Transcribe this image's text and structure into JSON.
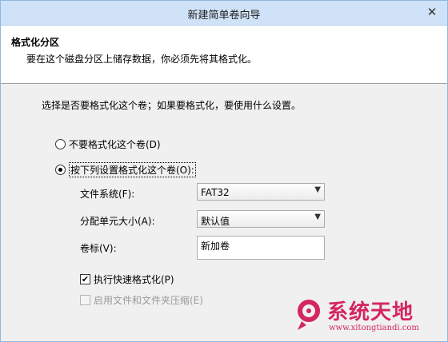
{
  "window": {
    "title": "新建简单卷向导",
    "close_glyph": "✕"
  },
  "header": {
    "title": "格式化分区",
    "subtitle": "要在这个磁盘分区上储存数据，你必须先将其格式化。"
  },
  "main": {
    "description": "选择是否要格式化这个卷；如果要格式化，要使用什么设置。",
    "radio_no_format": {
      "label": "不要格式化这个卷(D)",
      "checked": false
    },
    "radio_format": {
      "label": "按下列设置格式化这个卷(O):",
      "checked": true
    },
    "file_system": {
      "label": "文件系统(F):",
      "value": "FAT32"
    },
    "allocation_unit": {
      "label": "分配单元大小(A):",
      "value": "默认值"
    },
    "volume_label": {
      "label": "卷标(V):",
      "value": "新加卷"
    },
    "quick_format": {
      "label": "执行快速格式化(P)",
      "checked": true,
      "mark": "✔"
    },
    "compression": {
      "label": "启用文件和文件夹压缩(E)",
      "checked": false,
      "enabled": false
    }
  },
  "watermark": {
    "text": "系统天地",
    "url": "www.xitongtiandi.com"
  }
}
